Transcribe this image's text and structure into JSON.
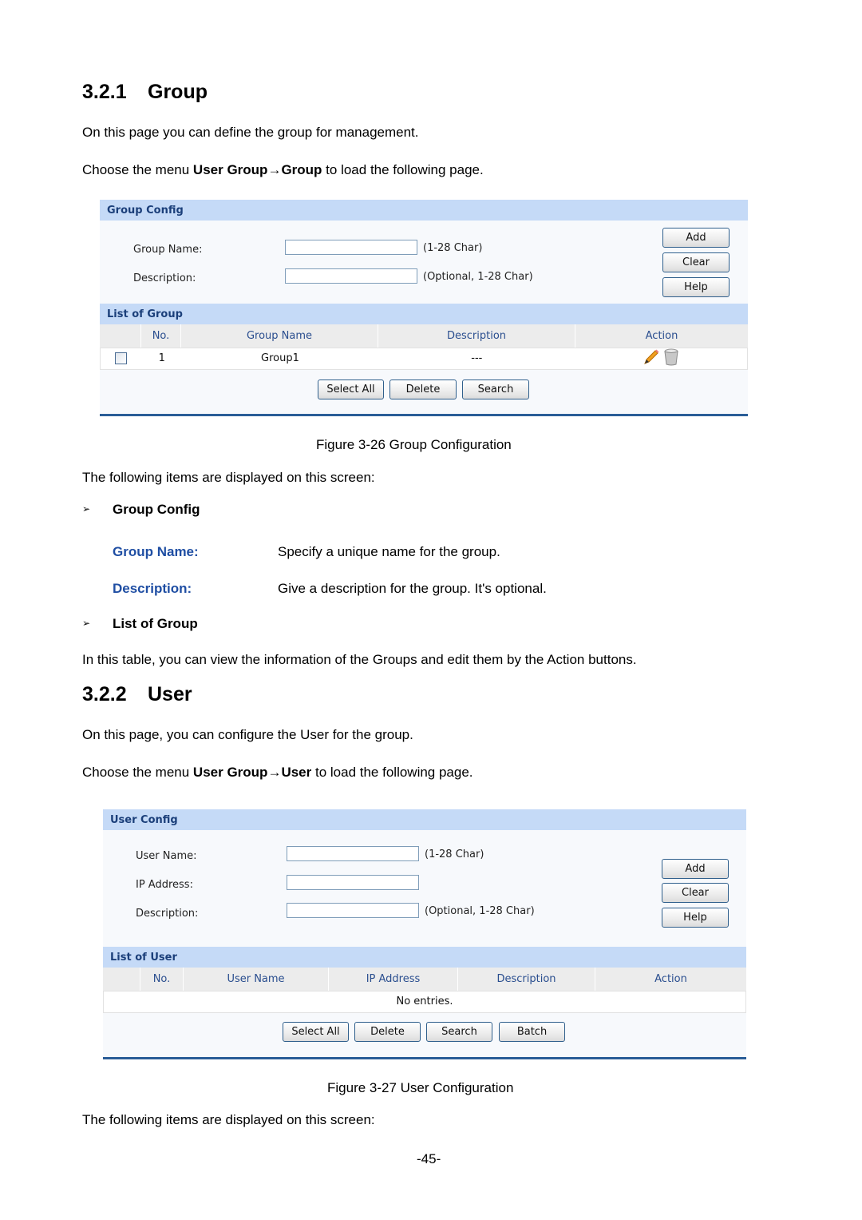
{
  "section_group": {
    "number": "3.2.1",
    "title": "Group",
    "intro": "On this page you can define the group for management.",
    "menu_prefix": "Choose the menu ",
    "menu_path_1": "User Group",
    "menu_arrow": "→",
    "menu_path_2": "Group",
    "menu_suffix": " to load the following page."
  },
  "group_ui": {
    "config_header": "Group Config",
    "fields": [
      {
        "label": "Group Name:",
        "value": "",
        "hint": "(1-28 Char)"
      },
      {
        "label": "Description:",
        "value": "",
        "hint": "(Optional, 1-28 Char)"
      }
    ],
    "buttons": {
      "add": "Add",
      "clear": "Clear",
      "help": "Help"
    },
    "list_header": "List of Group",
    "columns": [
      "",
      "No.",
      "Group Name",
      "Description",
      "Action"
    ],
    "rows": [
      {
        "checked": false,
        "no": "1",
        "name": "Group1",
        "description": "---",
        "actions": [
          "edit-icon",
          "delete-icon"
        ]
      }
    ],
    "list_buttons": {
      "select_all": "Select All",
      "delete": "Delete",
      "search": "Search"
    }
  },
  "figure_26": "Figure 3-26 Group Configuration",
  "items_intro_1": "The following items are displayed on this screen:",
  "bullets": {
    "group_config": "Group Config",
    "list_of_group": "List of Group"
  },
  "terms": [
    {
      "term": "Group Name:",
      "desc": "Specify a unique name for the group."
    },
    {
      "term": "Description:",
      "desc": "Give a description for the group. It's optional."
    }
  ],
  "list_of_group_text": "In this table, you can view the information of the Groups and edit them by the Action buttons.",
  "section_user": {
    "number": "3.2.2",
    "title": "User",
    "intro": "On this page, you can configure the User for the group.",
    "menu_prefix": "Choose the menu ",
    "menu_path_1": "User Group",
    "menu_arrow": "→",
    "menu_path_2": "User",
    "menu_suffix": " to load the following page."
  },
  "user_ui": {
    "config_header": "User Config",
    "fields": [
      {
        "label": "User Name:",
        "value": "",
        "hint": "(1-28 Char)"
      },
      {
        "label": "IP Address:",
        "value": "",
        "hint": ""
      },
      {
        "label": "Description:",
        "value": "",
        "hint": "(Optional, 1-28 Char)"
      }
    ],
    "buttons": {
      "add": "Add",
      "clear": "Clear",
      "help": "Help"
    },
    "list_header": "List of User",
    "columns": [
      "",
      "No.",
      "User Name",
      "IP Address",
      "Description",
      "Action"
    ],
    "empty_text": "No entries.",
    "list_buttons": {
      "select_all": "Select All",
      "delete": "Delete",
      "search": "Search",
      "batch": "Batch"
    }
  },
  "figure_27": "Figure 3-27 User Configuration",
  "items_intro_2": "The following items are displayed on this screen:",
  "page_number": "-45-"
}
